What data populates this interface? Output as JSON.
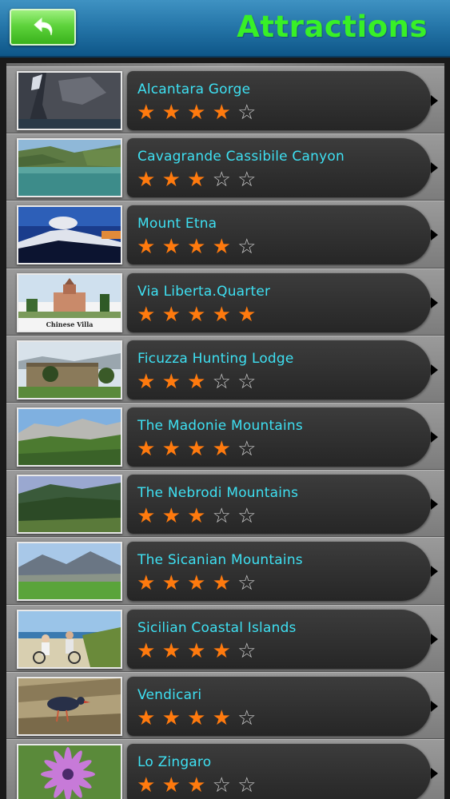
{
  "header": {
    "title": "Attractions",
    "back_icon": "back-arrow-icon",
    "colors": {
      "title": "#38f027",
      "bar": "#2677aa",
      "back_button": "#5ed33c"
    }
  },
  "list": {
    "name_color": "#3ee0f2",
    "star_color": "#ff7a0e",
    "items": [
      {
        "name": "Alcantara Gorge",
        "rating": 4
      },
      {
        "name": "Cavagrande Cassibile Canyon",
        "rating": 3
      },
      {
        "name": "Mount Etna",
        "rating": 4
      },
      {
        "name": "Via Liberta.Quarter",
        "rating": 5,
        "thumb_caption": "Chinese Villa"
      },
      {
        "name": "Ficuzza Hunting Lodge",
        "rating": 3
      },
      {
        "name": "The Madonie Mountains",
        "rating": 4
      },
      {
        "name": "The Nebrodi Mountains",
        "rating": 3
      },
      {
        "name": "The Sicanian Mountains",
        "rating": 4
      },
      {
        "name": "Sicilian Coastal Islands",
        "rating": 4
      },
      {
        "name": "Vendicari",
        "rating": 4
      },
      {
        "name": "Lo Zingaro",
        "rating": 3
      }
    ]
  }
}
